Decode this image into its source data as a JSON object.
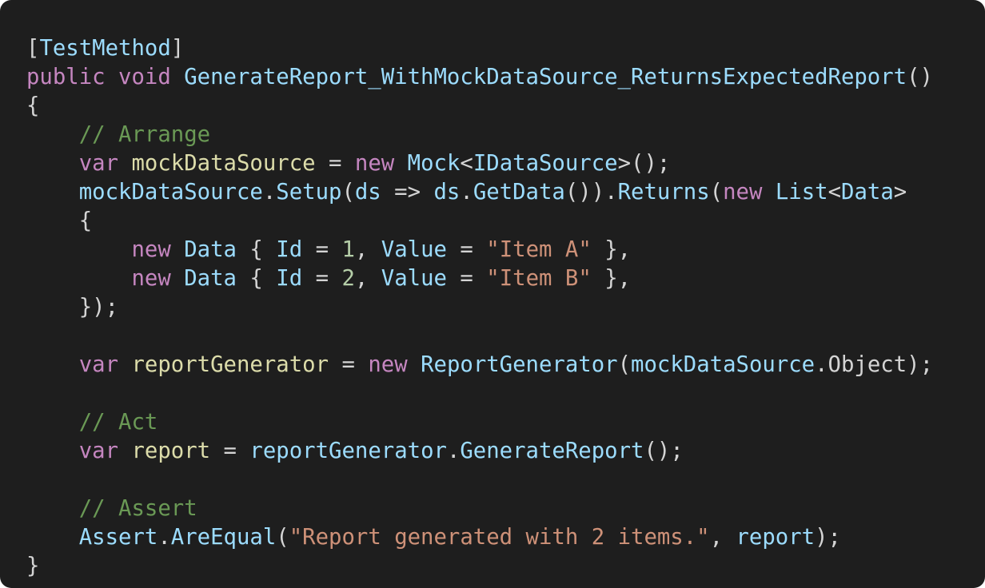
{
  "colors": {
    "background": "#1e1e1e",
    "keyword": "#c586c0",
    "type": "#9cdcfe",
    "variable": "#dcdcaa",
    "string": "#ce9178",
    "number": "#b5cea8",
    "comment": "#6a9955",
    "punctuation": "#d4d4d4"
  },
  "code": {
    "language": "C#",
    "lines": [
      [
        [
          "punc",
          "["
        ],
        [
          "type",
          "TestMethod"
        ],
        [
          "punc",
          "]"
        ]
      ],
      [
        [
          "kw",
          "public"
        ],
        [
          "plain",
          " "
        ],
        [
          "kw",
          "void"
        ],
        [
          "plain",
          " "
        ],
        [
          "type",
          "GenerateReport_WithMockDataSource_ReturnsExpectedReport"
        ],
        [
          "punc",
          "()"
        ]
      ],
      [
        [
          "punc",
          "{"
        ]
      ],
      [
        [
          "plain",
          "    "
        ],
        [
          "com",
          "// Arrange"
        ]
      ],
      [
        [
          "plain",
          "    "
        ],
        [
          "kw",
          "var"
        ],
        [
          "plain",
          " "
        ],
        [
          "var",
          "mockDataSource"
        ],
        [
          "plain",
          " = "
        ],
        [
          "kw",
          "new"
        ],
        [
          "plain",
          " "
        ],
        [
          "type",
          "Mock"
        ],
        [
          "punc",
          "<"
        ],
        [
          "type",
          "IDataSource"
        ],
        [
          "punc",
          ">();"
        ]
      ],
      [
        [
          "plain",
          "    "
        ],
        [
          "type",
          "mockDataSource"
        ],
        [
          "punc",
          "."
        ],
        [
          "type",
          "Setup"
        ],
        [
          "punc",
          "("
        ],
        [
          "type",
          "ds"
        ],
        [
          "plain",
          " => "
        ],
        [
          "type",
          "ds"
        ],
        [
          "punc",
          "."
        ],
        [
          "type",
          "GetData"
        ],
        [
          "punc",
          "())."
        ],
        [
          "type",
          "Returns"
        ],
        [
          "punc",
          "("
        ],
        [
          "kw",
          "new"
        ],
        [
          "plain",
          " "
        ],
        [
          "type",
          "List"
        ],
        [
          "punc",
          "<"
        ],
        [
          "type",
          "Data"
        ],
        [
          "punc",
          ">"
        ]
      ],
      [
        [
          "plain",
          "    "
        ],
        [
          "punc",
          "{"
        ]
      ],
      [
        [
          "plain",
          "        "
        ],
        [
          "kw",
          "new"
        ],
        [
          "plain",
          " "
        ],
        [
          "type",
          "Data"
        ],
        [
          "plain",
          " { "
        ],
        [
          "type",
          "Id"
        ],
        [
          "plain",
          " = "
        ],
        [
          "num",
          "1"
        ],
        [
          "punc",
          ", "
        ],
        [
          "type",
          "Value"
        ],
        [
          "plain",
          " = "
        ],
        [
          "str",
          "\"Item A\""
        ],
        [
          "plain",
          " },"
        ]
      ],
      [
        [
          "plain",
          "        "
        ],
        [
          "kw",
          "new"
        ],
        [
          "plain",
          " "
        ],
        [
          "type",
          "Data"
        ],
        [
          "plain",
          " { "
        ],
        [
          "type",
          "Id"
        ],
        [
          "plain",
          " = "
        ],
        [
          "num",
          "2"
        ],
        [
          "punc",
          ", "
        ],
        [
          "type",
          "Value"
        ],
        [
          "plain",
          " = "
        ],
        [
          "str",
          "\"Item B\""
        ],
        [
          "plain",
          " },"
        ]
      ],
      [
        [
          "plain",
          "    "
        ],
        [
          "punc",
          "});"
        ]
      ],
      [],
      [
        [
          "plain",
          "    "
        ],
        [
          "kw",
          "var"
        ],
        [
          "plain",
          " "
        ],
        [
          "var",
          "reportGenerator"
        ],
        [
          "plain",
          " = "
        ],
        [
          "kw",
          "new"
        ],
        [
          "plain",
          " "
        ],
        [
          "type",
          "ReportGenerator"
        ],
        [
          "punc",
          "("
        ],
        [
          "type",
          "mockDataSource"
        ],
        [
          "punc",
          ".Object);"
        ]
      ],
      [],
      [
        [
          "plain",
          "    "
        ],
        [
          "com",
          "// Act"
        ]
      ],
      [
        [
          "plain",
          "    "
        ],
        [
          "kw",
          "var"
        ],
        [
          "plain",
          " "
        ],
        [
          "var",
          "report"
        ],
        [
          "plain",
          " = "
        ],
        [
          "type",
          "reportGenerator"
        ],
        [
          "punc",
          "."
        ],
        [
          "type",
          "GenerateReport"
        ],
        [
          "punc",
          "();"
        ]
      ],
      [],
      [
        [
          "plain",
          "    "
        ],
        [
          "com",
          "// Assert"
        ]
      ],
      [
        [
          "plain",
          "    "
        ],
        [
          "type",
          "Assert"
        ],
        [
          "punc",
          "."
        ],
        [
          "type",
          "AreEqual"
        ],
        [
          "punc",
          "("
        ],
        [
          "str",
          "\"Report generated with 2 items.\""
        ],
        [
          "punc",
          ", "
        ],
        [
          "type",
          "report"
        ],
        [
          "punc",
          ");"
        ]
      ],
      [
        [
          "punc",
          "}"
        ]
      ]
    ]
  }
}
